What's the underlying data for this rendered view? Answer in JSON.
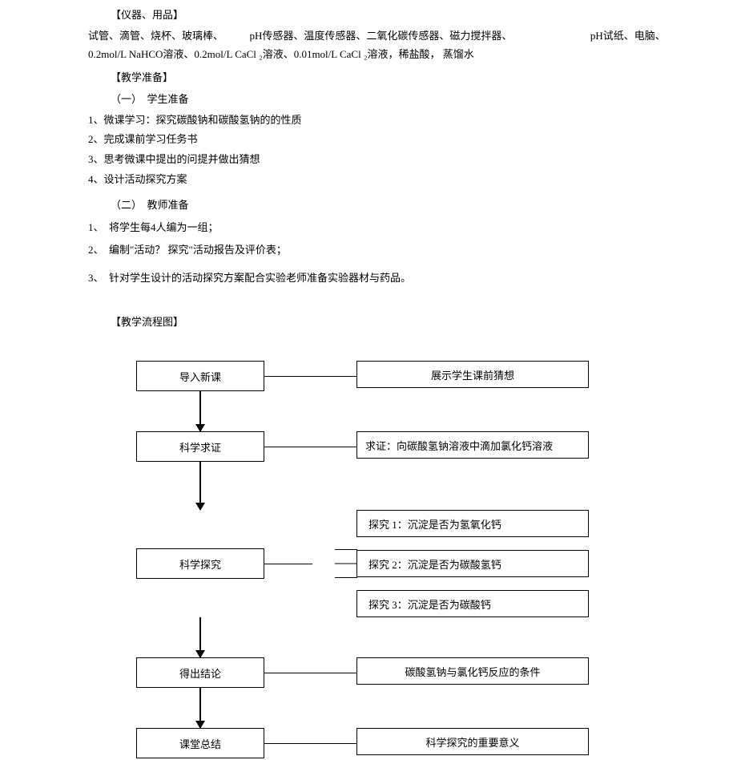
{
  "headings": {
    "instruments": "【仪器、用品】",
    "preparation": "【教学准备】",
    "flow": "【教学流程图】"
  },
  "instruments_text": "试管、滴管、烧杯、玻璃棒、　　　pH传感器、温度传感器、二氧化碳传感器、磁力搅拌器、　　　　　　　　pH试纸、电脑、 0.2mol/L NaHCO溶液、0.2mol/L CaCl ₂溶液、0.01mol/L CaCl ₂溶液，稀盐酸，  蒸馏水",
  "prep_sub1": "（一）　学生准备",
  "prep_items1": [
    "1、微课学习：探究碳酸钠和碳酸氢钠的的性质",
    "2、完成课前学习任务书",
    "3、思考微课中提出的问提并做出猜想",
    "4、设计活动探究方案"
  ],
  "prep_sub2": "（二）　教师准备",
  "prep_items2": [
    "1、　将学生每4人编为一组；",
    "2、　编制\"活动？ 探究\"活动报告及评价表；",
    "3、　针对学生设计的活动探究方案配合实验老师准备实验器材与药品。"
  ],
  "flow": {
    "n1_left": "导入新课",
    "n1_right": "展示学生课前猜想",
    "n2_left": "科学求证",
    "n2_right": "求证：向碳酸氢钠溶液中滴加氯化钙溶液",
    "n3_left": "科学探究",
    "n3_r1": "探究 1：沉淀是否为氢氧化钙",
    "n3_r2": "探究 2：沉淀是否为碳酸氢钙",
    "n3_r3": "探究 3：沉淀是否为碳酸钙",
    "n4_left": "得出结论",
    "n4_right": "碳酸氢钠与氯化钙反应的条件",
    "n5_left": "课堂总结",
    "n5_right": "科学探究的重要意义"
  }
}
